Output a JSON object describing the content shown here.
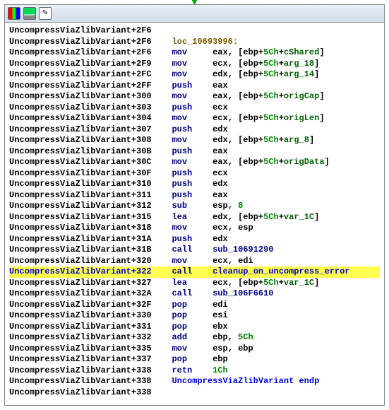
{
  "titlebar": {
    "icons": [
      "colors-icon",
      "monitor-icon",
      "pencil-icon"
    ],
    "arrow": "▼"
  },
  "function_name": "UncompressViaZlibVariant",
  "rows": [
    {
      "off": "2F6",
      "mnem": "",
      "ops": []
    },
    {
      "off": "2F6",
      "label": "loc_10693996:"
    },
    {
      "off": "2F6",
      "mnem": "mov",
      "ops": [
        "eax",
        ", ",
        "[",
        "ebp",
        "+",
        "5Ch",
        "+",
        "cShared",
        "]"
      ]
    },
    {
      "off": "2F9",
      "mnem": "mov",
      "ops": [
        "ecx",
        ", ",
        "[",
        "ebp",
        "+",
        "5Ch",
        "+",
        "arg_18",
        "]"
      ]
    },
    {
      "off": "2FC",
      "mnem": "mov",
      "ops": [
        "edx",
        ", ",
        "[",
        "ebp",
        "+",
        "5Ch",
        "+",
        "arg_14",
        "]"
      ]
    },
    {
      "off": "2FF",
      "mnem": "push",
      "ops": [
        "eax"
      ]
    },
    {
      "off": "300",
      "mnem": "mov",
      "ops": [
        "eax",
        ", ",
        "[",
        "ebp",
        "+",
        "5Ch",
        "+",
        "origCap",
        "]"
      ]
    },
    {
      "off": "303",
      "mnem": "push",
      "ops": [
        "ecx"
      ]
    },
    {
      "off": "304",
      "mnem": "mov",
      "ops": [
        "ecx",
        ", ",
        "[",
        "ebp",
        "+",
        "5Ch",
        "+",
        "origLen",
        "]"
      ]
    },
    {
      "off": "307",
      "mnem": "push",
      "ops": [
        "edx"
      ]
    },
    {
      "off": "308",
      "mnem": "mov",
      "ops": [
        "edx",
        ", ",
        "[",
        "ebp",
        "+",
        "5Ch",
        "+",
        "arg_8",
        "]"
      ]
    },
    {
      "off": "30B",
      "mnem": "push",
      "ops": [
        "eax"
      ]
    },
    {
      "off": "30C",
      "mnem": "mov",
      "ops": [
        "eax",
        ", ",
        "[",
        "ebp",
        "+",
        "5Ch",
        "+",
        "origData",
        "]"
      ]
    },
    {
      "off": "30F",
      "mnem": "push",
      "ops": [
        "ecx"
      ]
    },
    {
      "off": "310",
      "mnem": "push",
      "ops": [
        "edx"
      ]
    },
    {
      "off": "311",
      "mnem": "push",
      "ops": [
        "eax"
      ]
    },
    {
      "off": "312",
      "mnem": "sub",
      "ops": [
        "esp",
        ", ",
        "8"
      ]
    },
    {
      "off": "315",
      "mnem": "lea",
      "ops": [
        "edx",
        ", ",
        "[",
        "ebp",
        "+",
        "5Ch",
        "+",
        "var_1C",
        "]"
      ]
    },
    {
      "off": "318",
      "mnem": "mov",
      "ops": [
        "ecx",
        ", ",
        "esp"
      ]
    },
    {
      "off": "31A",
      "mnem": "push",
      "ops": [
        "edx"
      ]
    },
    {
      "off": "31B",
      "mnem": "call",
      "ops_sub": "sub_10691290"
    },
    {
      "off": "320",
      "mnem": "mov",
      "ops": [
        "ecx",
        ", ",
        "edi"
      ]
    },
    {
      "off": "322",
      "mnem": "call",
      "ops_sub": "cleanup_on_uncompress_error",
      "highlight": true,
      "blue_fn": true
    },
    {
      "off": "327",
      "mnem": "lea",
      "ops": [
        "ecx",
        ", ",
        "[",
        "ebp",
        "+",
        "5Ch",
        "+",
        "var_1C",
        "]"
      ]
    },
    {
      "off": "32A",
      "mnem": "call",
      "ops_sub": "sub_106F6610"
    },
    {
      "off": "32F",
      "mnem": "pop",
      "ops": [
        "edi"
      ]
    },
    {
      "off": "330",
      "mnem": "pop",
      "ops": [
        "esi"
      ]
    },
    {
      "off": "331",
      "mnem": "pop",
      "ops": [
        "ebx"
      ]
    },
    {
      "off": "332",
      "mnem": "add",
      "ops": [
        "ebp",
        ", ",
        "5Ch"
      ]
    },
    {
      "off": "335",
      "mnem": "mov",
      "ops": [
        "esp",
        ", ",
        "ebp"
      ]
    },
    {
      "off": "337",
      "mnem": "pop",
      "ops": [
        "ebp"
      ]
    },
    {
      "off": "338",
      "mnem": "retn",
      "ops_hex": "1Ch"
    },
    {
      "off": "338",
      "endp": "UncompressViaZlibVariant endp"
    },
    {
      "off": "338"
    }
  ],
  "cols": {
    "mnem": 32,
    "ops": 40
  },
  "colors": {
    "mnemonic": "#000080",
    "hex": "#008000",
    "var": "#006000",
    "label": "#7a5b00",
    "sub": "#000080",
    "highlight": "#ffff50",
    "endp": "#0000d0"
  }
}
